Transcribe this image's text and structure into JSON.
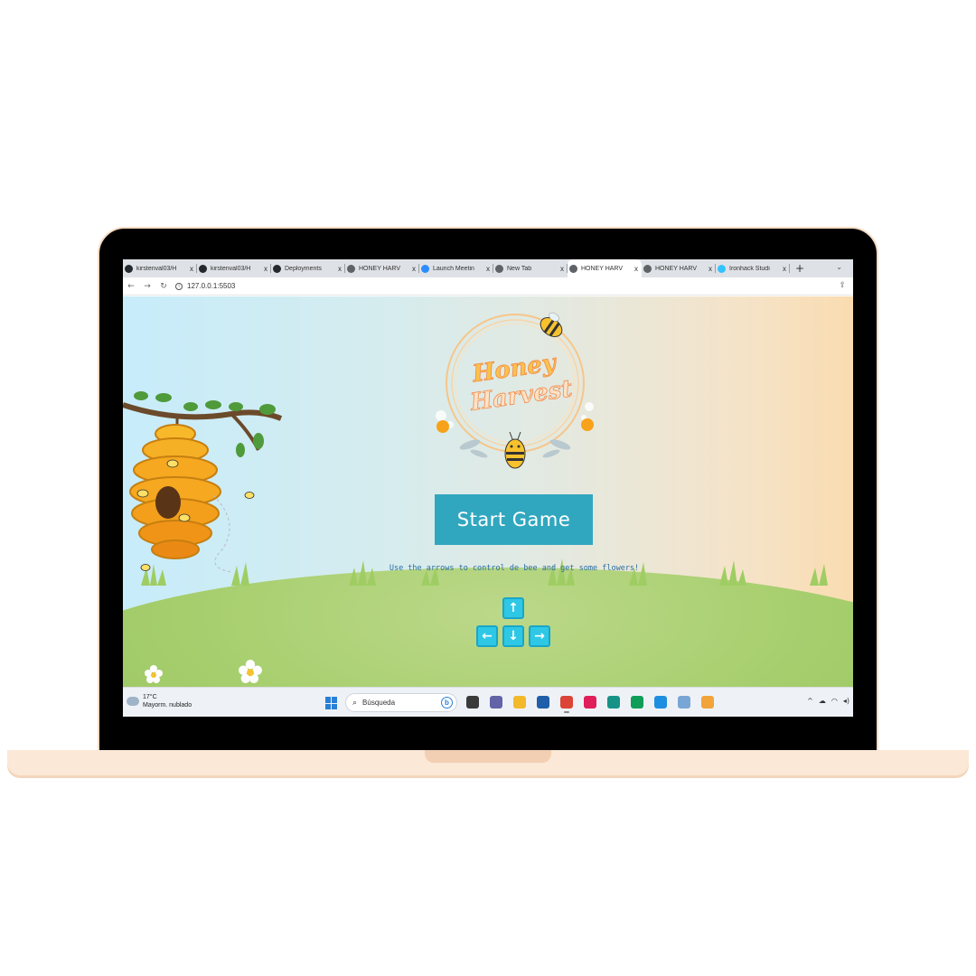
{
  "browser": {
    "tabs": [
      {
        "title": "kirstenval03/H",
        "favicon": "github-icon",
        "color": "#24292f",
        "active": false
      },
      {
        "title": "kirstenval03/H",
        "favicon": "github-icon",
        "color": "#24292f",
        "active": false
      },
      {
        "title": "Deployments",
        "favicon": "github-icon",
        "color": "#24292f",
        "active": false
      },
      {
        "title": "HONEY HARV",
        "favicon": "globe-icon",
        "color": "#5f6368",
        "active": false
      },
      {
        "title": "Launch Meetin",
        "favicon": "zoom-icon",
        "color": "#2d8cff",
        "active": false
      },
      {
        "title": "New Tab",
        "favicon": "chrome-icon",
        "color": "#5f6368",
        "active": false
      },
      {
        "title": "HONEY HARV",
        "favicon": "globe-icon",
        "color": "#5f6368",
        "active": true
      },
      {
        "title": "HONEY HARV",
        "favicon": "globe-icon",
        "color": "#5f6368",
        "active": false
      },
      {
        "title": "Ironhack Studi",
        "favicon": "ironhack-icon",
        "color": "#32c3ff",
        "active": false
      }
    ],
    "close_glyph": "x",
    "new_tab_glyph": "+",
    "url": "127.0.0.1:5503"
  },
  "game": {
    "logo_line1": "Honey",
    "logo_line2": "Harvest",
    "start_button": "Start Game",
    "instructions": "Use the arrows to control de bee and get some flowers!",
    "arrow_keys": {
      "up": "↑",
      "left": "←",
      "down": "↓",
      "right": "→"
    }
  },
  "taskbar": {
    "temperature": "17°C",
    "weather": "Mayorm. nublado",
    "search_placeholder": "Búsqueda",
    "apps": [
      {
        "name": "task-view-icon",
        "color": "#3a3a3a"
      },
      {
        "name": "teams-icon",
        "color": "#6264a7"
      },
      {
        "name": "file-explorer-icon",
        "color": "#f3b92b"
      },
      {
        "name": "store-icon",
        "color": "#1f5ea8"
      },
      {
        "name": "chrome-icon",
        "color": "#db4437"
      },
      {
        "name": "slack-icon",
        "color": "#e01e5a"
      },
      {
        "name": "gitkraken-icon",
        "color": "#179287"
      },
      {
        "name": "chrome-profile-icon",
        "color": "#0f9d58"
      },
      {
        "name": "vscode-icon",
        "color": "#1e8ee0"
      },
      {
        "name": "photos-icon",
        "color": "#7aa6d6"
      },
      {
        "name": "paint-icon",
        "color": "#f2a33a"
      }
    ]
  }
}
